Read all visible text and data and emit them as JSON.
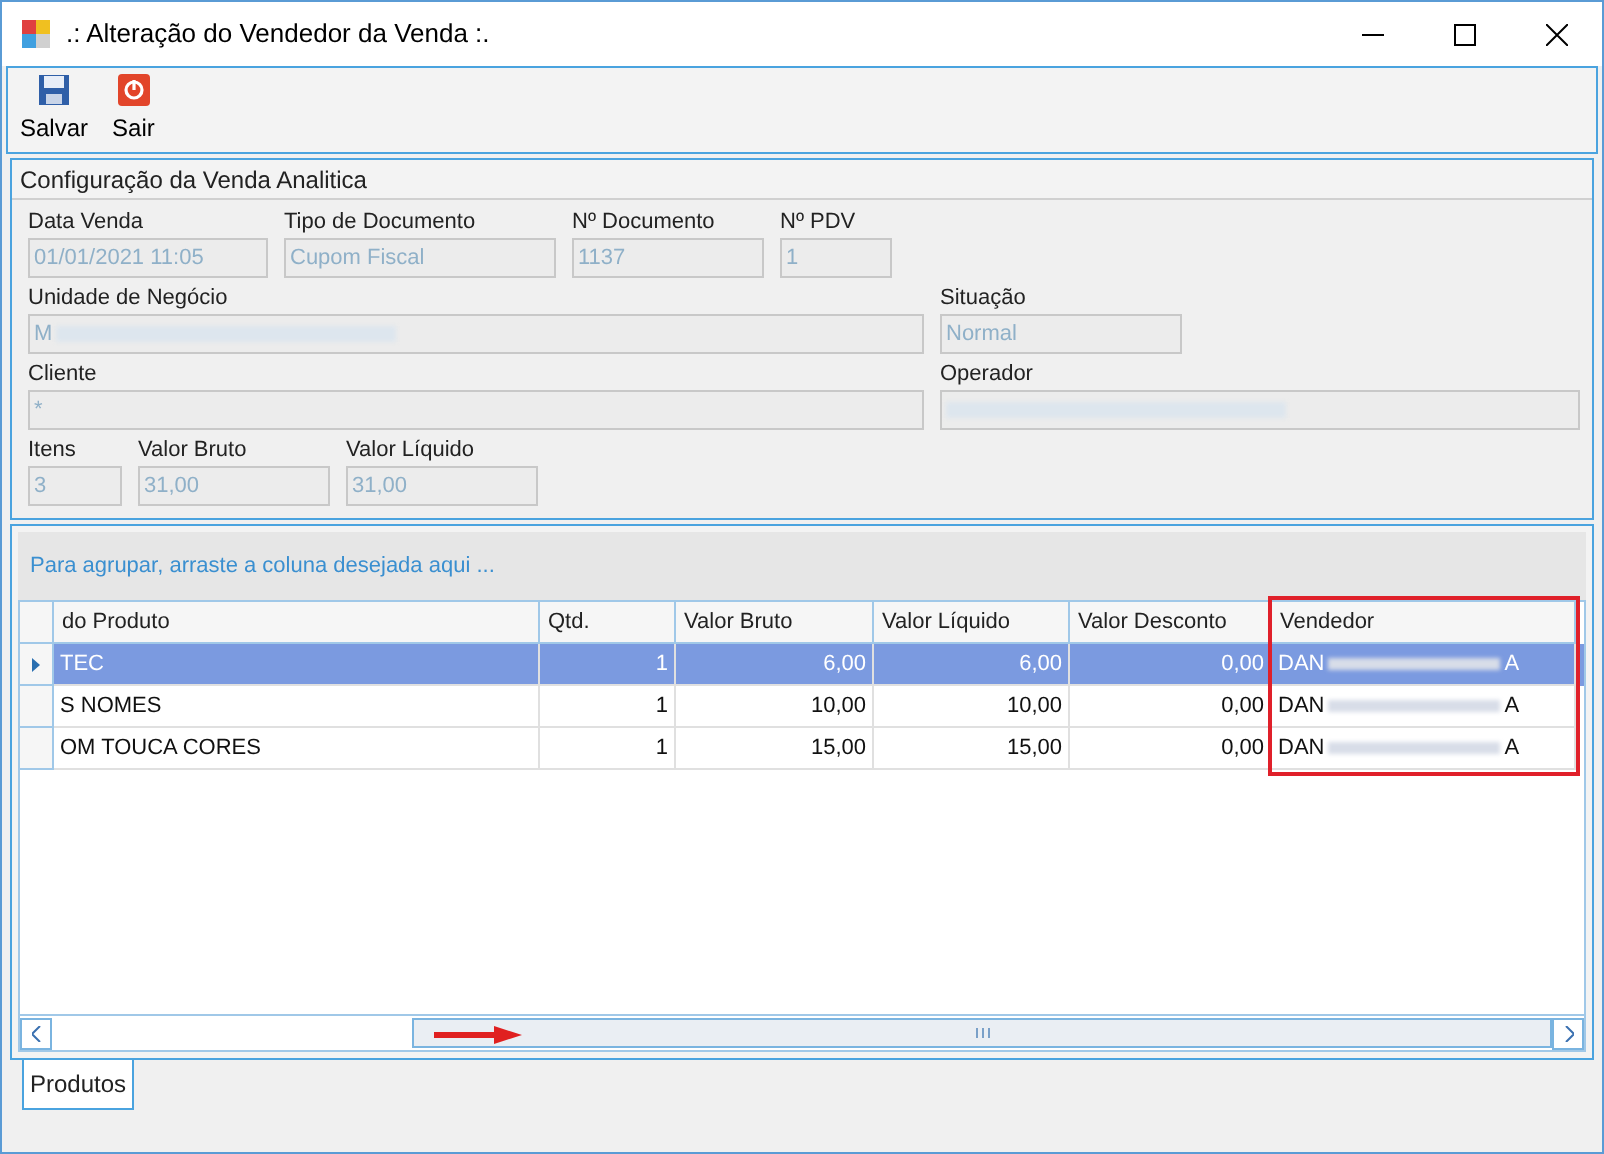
{
  "window": {
    "title": ".: Alteração do Vendedor da Venda :."
  },
  "toolbar": [
    {
      "kind": "save",
      "label": "Salvar"
    },
    {
      "kind": "exit",
      "label": "Sair"
    }
  ],
  "group": {
    "title": "Configuração da Venda Analitica",
    "fields": [
      {
        "label": "Data Venda",
        "value": "01/01/2021 11:05"
      },
      {
        "label": "Tipo de Documento",
        "value": "Cupom Fiscal"
      },
      {
        "label": "Nº Documento",
        "value": "1137"
      },
      {
        "label": "Nº PDV",
        "value": "1"
      },
      {
        "label": "Unidade de Negócio",
        "value": "M",
        "redacted": true
      },
      {
        "label": "Situação",
        "value": "Normal"
      },
      {
        "label": "Cliente",
        "value": "*"
      },
      {
        "label": "Operador",
        "redacted": true
      },
      {
        "label": "Itens",
        "value": "3"
      },
      {
        "label": "Valor Bruto",
        "value": "31,00"
      },
      {
        "label": "Valor Líquido",
        "value": "31,00"
      }
    ]
  },
  "grid": {
    "group_hint": "Para agrupar, arraste a coluna desejada aqui ...",
    "columns": [
      {
        "label": "do Produto"
      },
      {
        "label": "Qtd."
      },
      {
        "label": "Valor Bruto"
      },
      {
        "label": "Valor Líquido"
      },
      {
        "label": "Valor Desconto"
      },
      {
        "label": "Vendedor",
        "highlighted": true
      }
    ],
    "rows": [
      {
        "selected": true,
        "cells": [
          "TEC",
          "1",
          "6,00",
          "6,00",
          "0,00",
          "DAN"
        ],
        "vendor_tail": "A"
      },
      {
        "selected": false,
        "cells": [
          "S NOMES",
          "1",
          "10,00",
          "10,00",
          "0,00",
          "DAN"
        ],
        "vendor_tail": "A"
      },
      {
        "selected": false,
        "cells": [
          "OM TOUCA CORES",
          "1",
          "15,00",
          "15,00",
          "0,00",
          "DAN"
        ],
        "vendor_tail": "A"
      }
    ]
  },
  "tabs": [
    {
      "label": "Produtos",
      "selected": true
    }
  ]
}
